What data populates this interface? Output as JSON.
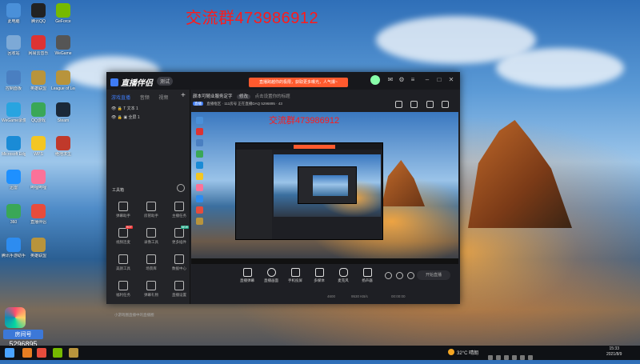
{
  "watermark": "交流群473986912",
  "desktop_icons": [
    {
      "label": "此电脑",
      "color": "#4a90d9"
    },
    {
      "label": "腾讯QQ",
      "color": "#222"
    },
    {
      "label": "GeForce",
      "color": "#76b900"
    },
    {
      "label": "回收站",
      "color": "#7da9d6"
    },
    {
      "label": "网易云音乐",
      "color": "#d33"
    },
    {
      "label": "WeGame",
      "color": "#555"
    },
    {
      "label": "控制面板",
      "color": "#4a7fc1"
    },
    {
      "label": "英雄联盟",
      "color": "#b8943c"
    },
    {
      "label": "League of Legends",
      "color": "#b8943c"
    },
    {
      "label": "WeGame录像",
      "color": "#28a4e0"
    },
    {
      "label": "QQ游戏",
      "color": "#3aa757"
    },
    {
      "label": "Steam",
      "color": "#1b2838"
    },
    {
      "label": "Microsoft Edge",
      "color": "#1a8bd6"
    },
    {
      "label": "WPS",
      "color": "#f3c623"
    },
    {
      "label": "绝地求生",
      "color": "#c0392b"
    },
    {
      "label": "迅雷",
      "color": "#1e90ff"
    },
    {
      "label": "哔哩哔哩",
      "color": "#fb7299"
    },
    {
      "label": "360",
      "color": "#3aa757"
    },
    {
      "label": "直播伴侣",
      "color": "#e74c3c"
    },
    {
      "label": "腾讯手游助手",
      "color": "#2d8cf0"
    },
    {
      "label": "英雄联盟",
      "color": "#b8943c"
    }
  ],
  "badge": {
    "pill": "房间号",
    "number": "5296895"
  },
  "app": {
    "logo": "直播伴侣",
    "version": "测试",
    "promo": "直播跨越你的极限，获取更多曝光，人气爆~",
    "sidebar_tabs": [
      "游戏直播",
      "音频",
      "视频",
      "",
      ""
    ],
    "scenes": [
      "文本 1",
      "全屏 1"
    ],
    "tools_title": "工具箱",
    "tools": [
      {
        "label": "弹幕助手",
        "tag": ""
      },
      {
        "label": "房管助手",
        "tag": ""
      },
      {
        "label": "主播任务",
        "tag": ""
      },
      {
        "label": "视频连麦",
        "tag": "HOT"
      },
      {
        "label": "录像工具",
        "tag": ""
      },
      {
        "label": "更多插件",
        "tag": "NEW"
      },
      {
        "label": "美颜工具",
        "tag": ""
      },
      {
        "label": "场景库",
        "tag": ""
      },
      {
        "label": "数据中心",
        "tag": ""
      },
      {
        "label": "福利任务",
        "tag": ""
      },
      {
        "label": "弹幕礼物",
        "tag": ""
      },
      {
        "label": "直播设置",
        "tag": ""
      }
    ],
    "side_note": "小游戏圈直播中的直播圈",
    "stream_title": "颜本可随业服务定字",
    "stream_tag": "修改",
    "stream_note": "点击设置你的标题",
    "sub_badge": "直播",
    "sub_line": "直播框区 · 111房号   正在直播DAQ   5296895   · 43",
    "controls": [
      "直播弹幕",
      "直播画面",
      "手机投屏",
      "多媒体",
      "麦克风",
      "扬声器"
    ],
    "go_live": "开始直播",
    "status": [
      "4600",
      "9530 KB/s",
      "00:00:00"
    ]
  },
  "preview": {
    "watermark": "交流群473986912"
  },
  "taskbar": {
    "weather": "32°C 晴朗",
    "time": "15:33",
    "date": "2021/8/9"
  }
}
